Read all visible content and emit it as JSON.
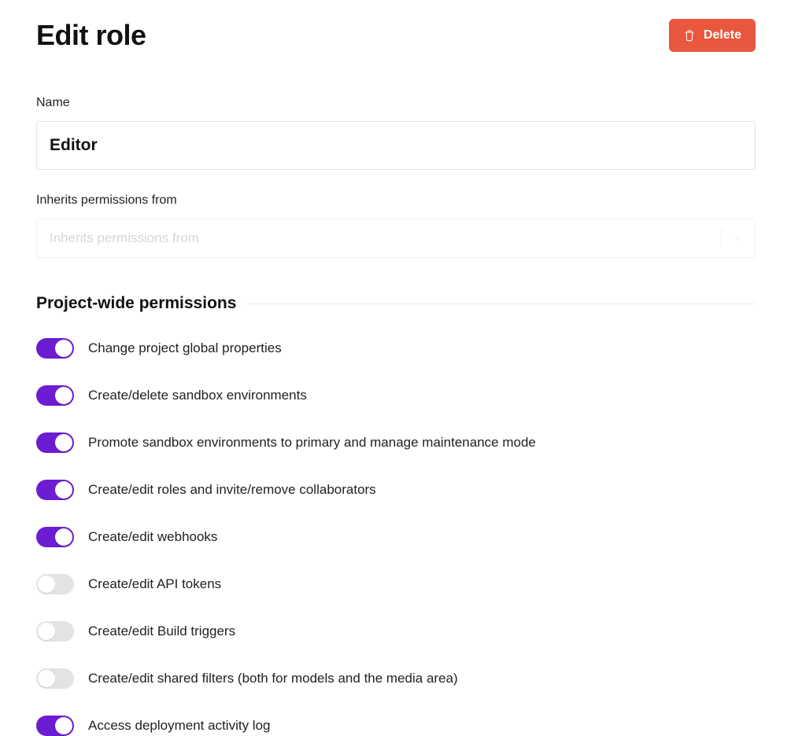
{
  "header": {
    "title": "Edit role",
    "delete_label": "Delete"
  },
  "fields": {
    "name_label": "Name",
    "name_value": "Editor",
    "inherits_label": "Inherits permissions from",
    "inherits_placeholder": "Inherits permissions from"
  },
  "section": {
    "title": "Project-wide permissions"
  },
  "permissions": [
    {
      "label": "Change project global properties",
      "on": true
    },
    {
      "label": "Create/delete sandbox environments",
      "on": true
    },
    {
      "label": "Promote sandbox environments to primary and manage maintenance mode",
      "on": true
    },
    {
      "label": "Create/edit roles and invite/remove collaborators",
      "on": true
    },
    {
      "label": "Create/edit webhooks",
      "on": true
    },
    {
      "label": "Create/edit API tokens",
      "on": false
    },
    {
      "label": "Create/edit Build triggers",
      "on": false
    },
    {
      "label": "Create/edit shared filters (both for models and the media area)",
      "on": false
    },
    {
      "label": "Access deployment activity log",
      "on": true
    }
  ]
}
